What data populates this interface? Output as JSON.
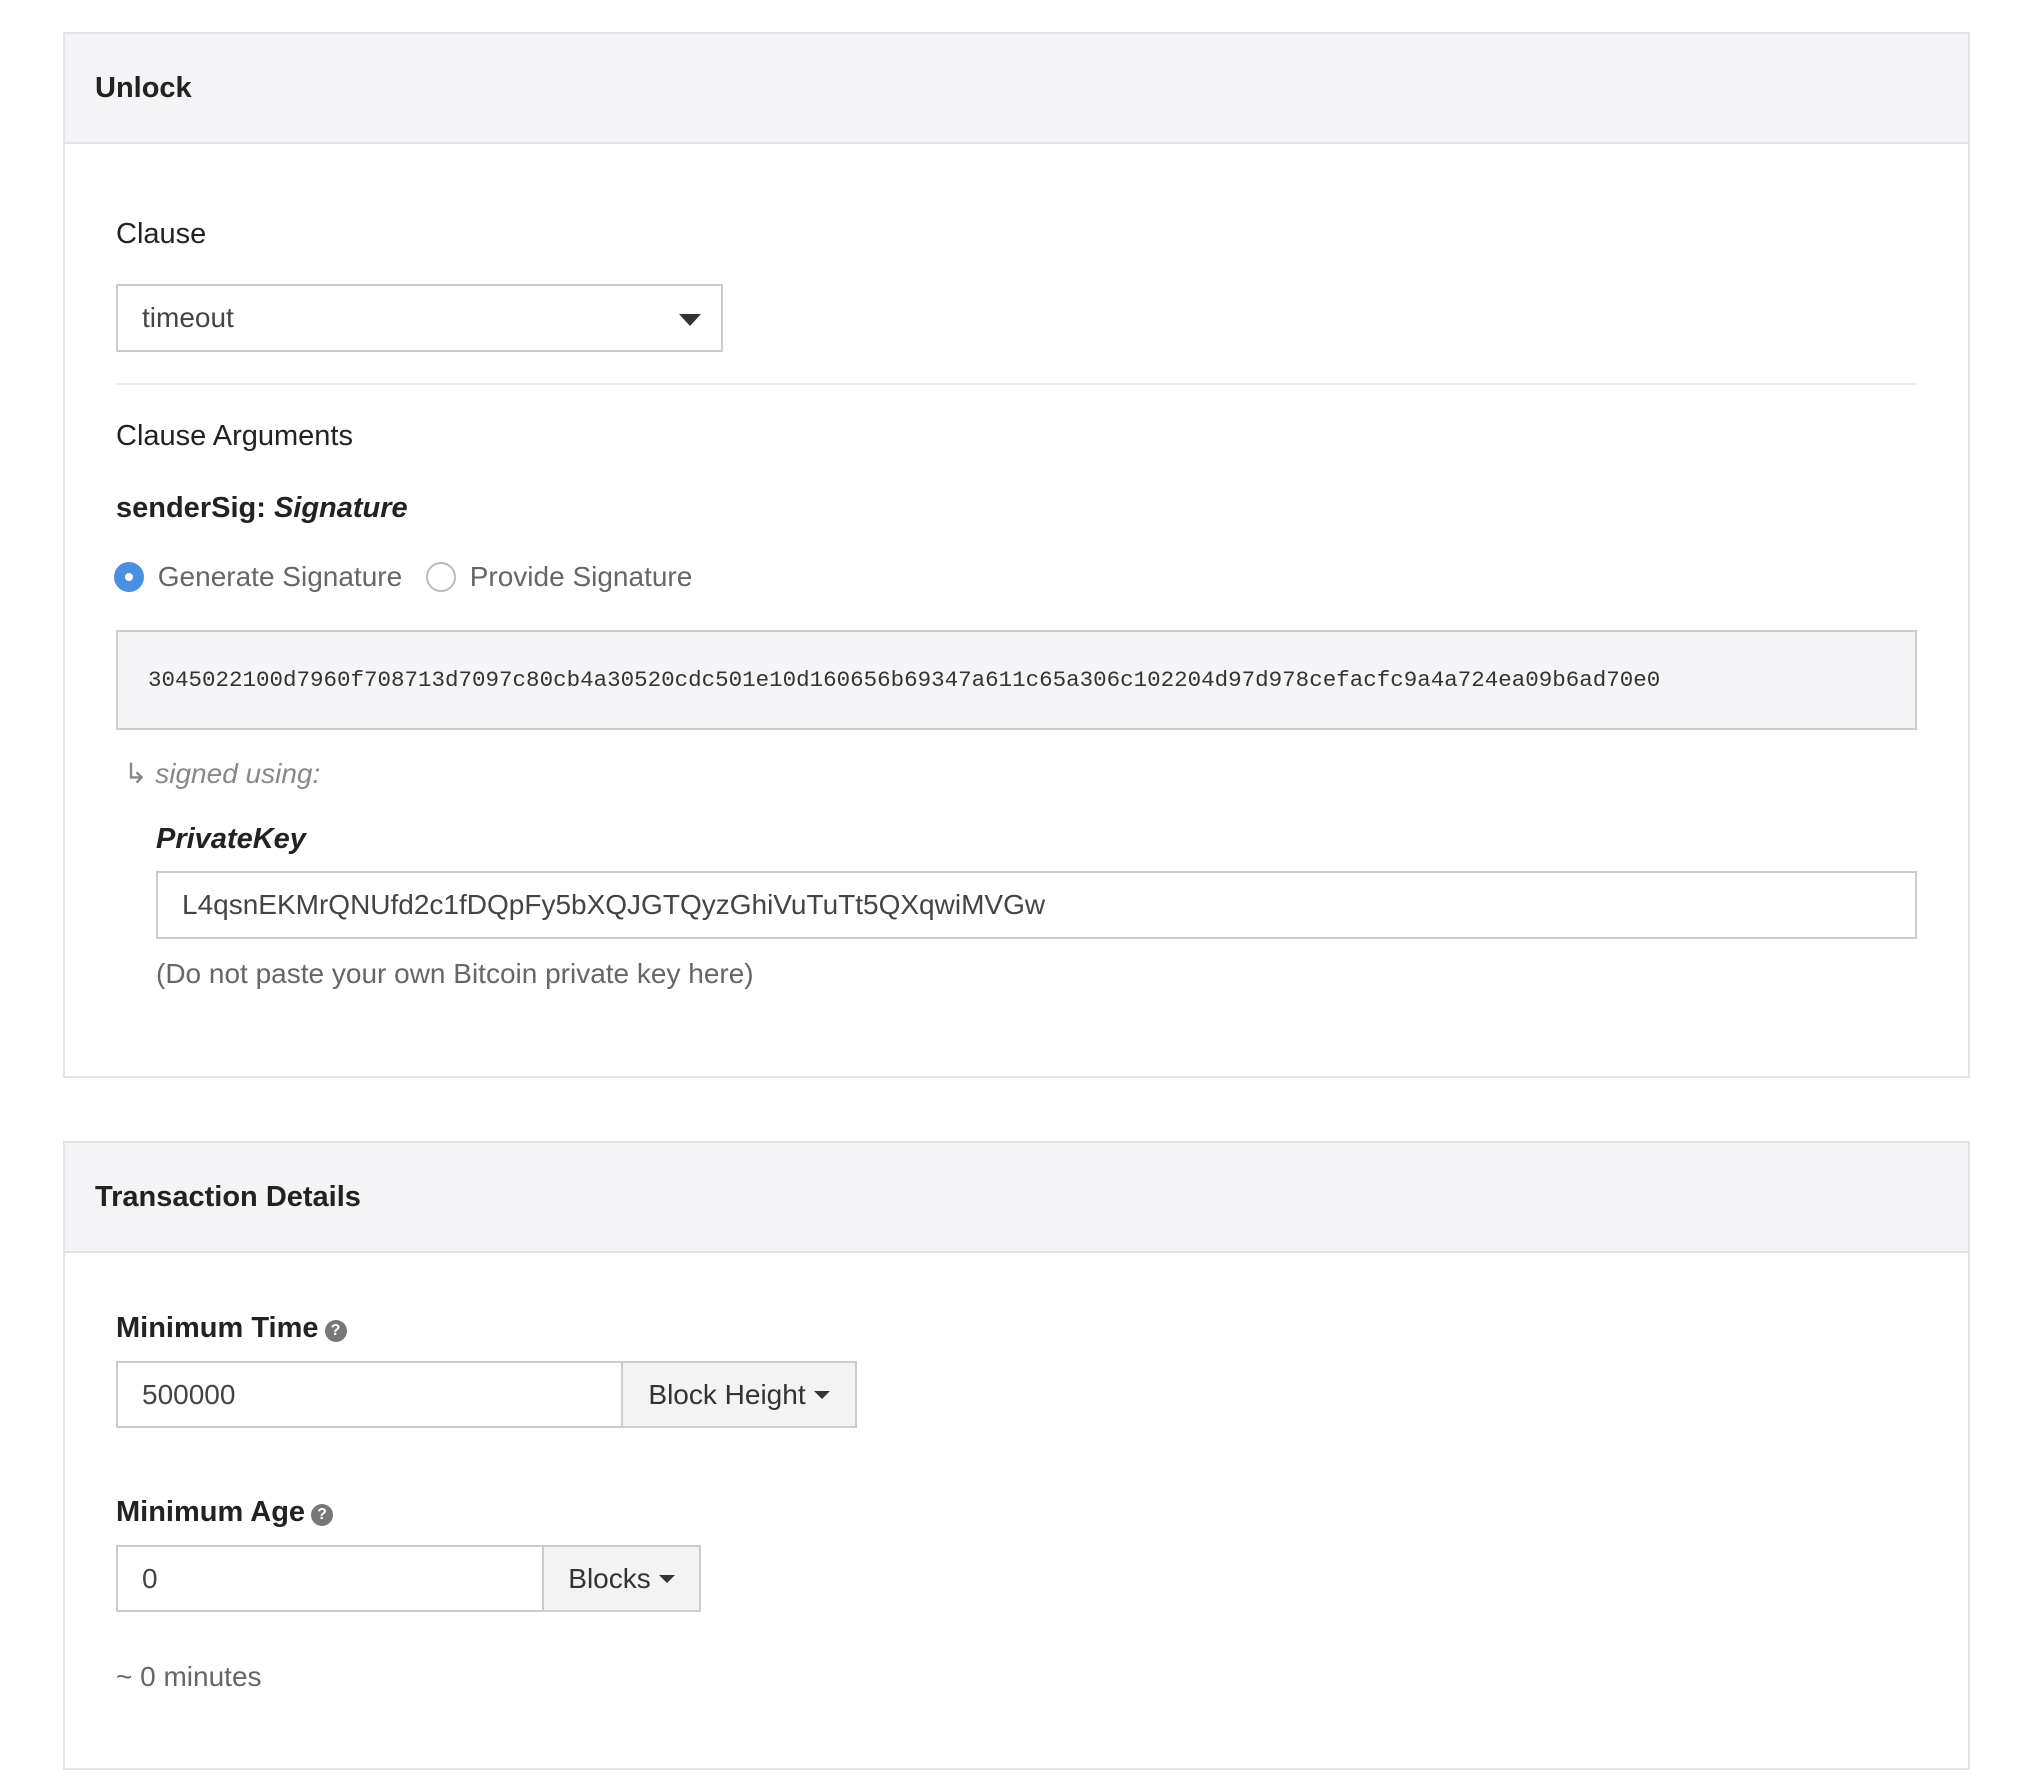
{
  "unlock": {
    "title": "Unlock",
    "clause_label": "Clause",
    "clause_value": "timeout",
    "clause_args_label": "Clause Arguments",
    "arg_name": "senderSig:",
    "arg_type": "Signature",
    "radio_generate": "Generate Signature",
    "radio_provide": "Provide Signature",
    "selected_radio": "Generate Signature",
    "signature": "3045022100d7960f708713d7097c80cb4a30520cdc501e10d160656b69347a611c65a306c102204d97d978cefacfc9a4a724ea09b6ad70e0",
    "signed_using_arrow": "↳",
    "signed_using": "signed using:",
    "private_key_label": "PrivateKey",
    "private_key_value": "L4qsnEKMrQNUfd2c1fDQpFy5bXQJGTQyzGhiVuTuTt5QXqwiMVGw",
    "private_key_hint": "(Do not paste your own Bitcoin private key here)"
  },
  "transaction": {
    "title": "Transaction Details",
    "min_time_label": "Minimum Time",
    "min_time_value": "500000",
    "min_time_unit": "Block Height",
    "min_age_label": "Minimum Age",
    "min_age_value": "0",
    "min_age_unit": "Blocks",
    "age_estimate": "~ 0 minutes",
    "help_glyph": "?"
  },
  "colors": {
    "accent": "#4a90e2",
    "header_bg": "#f4f4f6"
  }
}
